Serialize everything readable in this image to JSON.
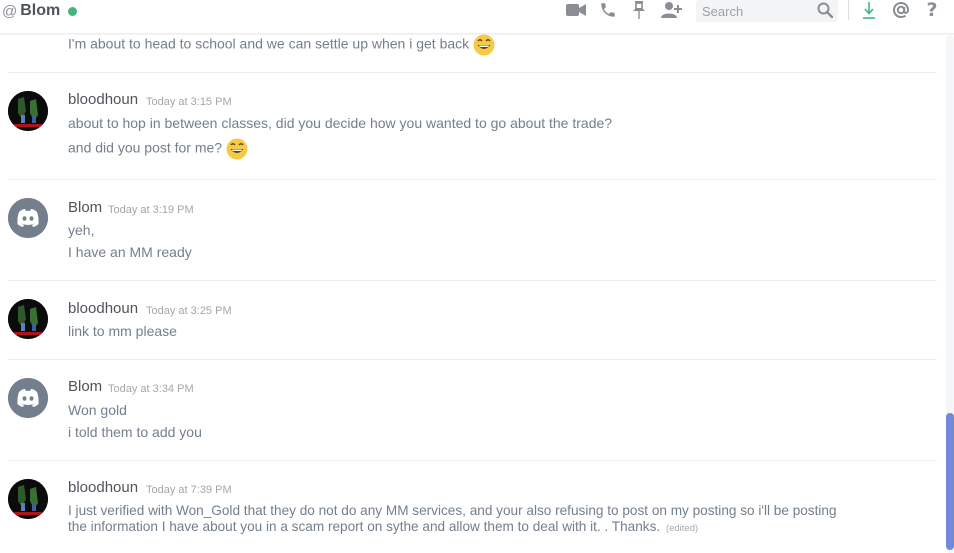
{
  "header": {
    "at_symbol": "@",
    "channel_name": "Blom",
    "status_color": "#43b581",
    "icons": [
      "video-camera-icon",
      "phone-icon",
      "pin-icon",
      "add-member-icon",
      "search-icon",
      "download-icon",
      "mention-icon",
      "help-icon"
    ],
    "search_placeholder": "Search"
  },
  "messages": {
    "g0": {
      "l1": "I'm about to head to school and we can settle up when i get back"
    },
    "g1": {
      "username": "bloodhoun",
      "timestamp": "Today at 3:15 PM",
      "l1": "about to hop in between classes, did you decide how you wanted to go about the trade?",
      "l2": "and did you post for me?"
    },
    "g2": {
      "username": "Blom",
      "timestamp": "Today at 3:19 PM",
      "l1": "yeh,",
      "l2": "I have an MM ready"
    },
    "g3": {
      "username": "bloodhoun",
      "timestamp": "Today at 3:25 PM",
      "l1": "link to mm please"
    },
    "g4": {
      "username": "Blom",
      "timestamp": "Today at 3:34 PM",
      "l1": "Won gold",
      "l2": "i told them to add you"
    },
    "g5": {
      "username": "bloodhoun",
      "timestamp": "Today at 7:39 PM",
      "l1": "I just verified with Won_Gold that they do not do any MM services, and your also refusing to post on my posting so i'll be posting",
      "l2": "the information I have about you in a scam report on sythe and allow them to deal with it. . Thanks.",
      "edited": "(edited)"
    }
  },
  "colors": {
    "accent": "#7289da",
    "online": "#43b581",
    "text": "#737f8d",
    "username": "#4f545c"
  }
}
